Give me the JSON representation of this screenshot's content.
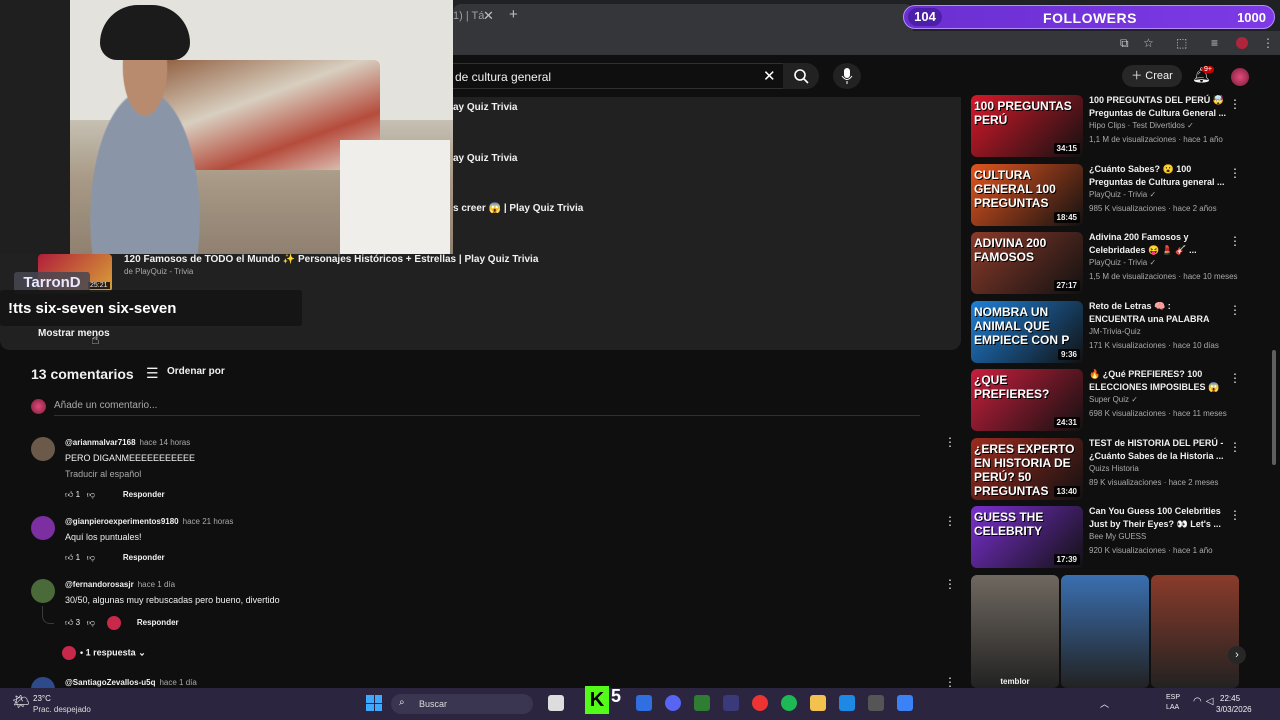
{
  "browser": {
    "tab_fragment": "1) | Tá",
    "tab_close": "✕",
    "new_tab": "+",
    "ext_icons": [
      "cast-icon",
      "star-icon",
      "puzzle-icon",
      "media-icon",
      "profile-icon",
      "menu-icon"
    ]
  },
  "overlay": {
    "followers_count": "104",
    "followers_label": "FOLLOWERS",
    "followers_goal": "1000",
    "streamer_name": "TarronD",
    "tts_message": "!tts six-seven six-seven"
  },
  "header": {
    "search_value": "de cultura general",
    "create_label": "Crear",
    "notifications_badge": "9+"
  },
  "playlist": {
    "rows": [
      {
        "title": "ay Quiz Trivia"
      },
      {
        "title": "ay Quiz Trivia"
      },
      {
        "title": "s creer 😱 | Play Quiz Trivia"
      }
    ],
    "last_item": {
      "title": "120 Famosos de TODO el Mundo ✨ Personajes Históricos + Estrellas | Play Quiz Trivia",
      "channel": "de PlayQuiz - Trivia",
      "duration": "25:21"
    },
    "show_less": "Mostrar menos"
  },
  "comments": {
    "count_label": "13 comentarios",
    "sort_label": "Ordenar por",
    "add_placeholder": "Añade un comentario...",
    "items": [
      {
        "handle": "@arianmalvar7168",
        "time": "hace 14 horas",
        "text": "PERO DIGANMEEEEEEEEEEE",
        "translate": "Traducir al español",
        "likes": "1",
        "reply": "Responder"
      },
      {
        "handle": "@gianpieroexperimentos9180",
        "time": "hace 21 horas",
        "text": "Aquí los puntuales!",
        "likes": "1",
        "reply": "Responder"
      },
      {
        "handle": "@fernandorosasjr",
        "time": "hace 1 día",
        "text": "30/50, algunas muy rebuscadas pero bueno, divertido",
        "likes": "3",
        "reply": "Responder"
      },
      {
        "handle": "@SantiagoZevallos-u5q",
        "time": "hace 1 día"
      }
    ],
    "replies_label": "• 1 respuesta"
  },
  "sidebar": {
    "videos": [
      {
        "thumb_text": "100 PREGUNTAS PERÚ",
        "duration": "34:15",
        "title": "100 PREGUNTAS DEL PERÚ 🤯 Preguntas de Cultura General ...",
        "channel": "Hipo Clips · Test Divertidos ✓",
        "meta": "1,1 M de visualizaciones · hace 1 año",
        "color": "#d7182a"
      },
      {
        "thumb_text": "CULTURA GENERAL 100 PREGUNTAS",
        "duration": "18:45",
        "title": "¿Cuánto Sabes? 😮 100 Preguntas de Cultura general ...",
        "channel": "PlayQuiz - Trivia ✓",
        "meta": "985 K visualizaciones · hace 2 años",
        "color": "#e2541f"
      },
      {
        "thumb_text": "ADIVINA 200 FAMOSOS",
        "duration": "27:17",
        "title": "Adivina 200 Famosos y Celebridades 😝 💄 🎸 ...",
        "channel": "PlayQuiz - Trivia ✓",
        "meta": "1,5 M de visualizaciones · hace 10 meses",
        "color": "#8a3a2a"
      },
      {
        "thumb_text": "NOMBRA UN ANIMAL QUE EMPIECE CON P",
        "duration": "9:36",
        "title": "Reto de Letras 🧠 : ENCUENTRA una PALABRA qu...",
        "channel": "JM-Trivia-Quiz",
        "meta": "171 K visualizaciones · hace 10 días",
        "color": "#1e7fd6"
      },
      {
        "thumb_text": "¿QUE PREFIERES?",
        "duration": "24:31",
        "title": "🔥 ¿Qué PREFIERES? 100 ELECCIONES IMPOSIBLES 😱 ...",
        "channel": "Super Quiz ✓",
        "meta": "698 K visualizaciones · hace 11 meses",
        "color": "#c81e3c"
      },
      {
        "thumb_text": "¿ERES EXPERTO EN HISTORIA DE PERÚ? 50 PREGUNTAS",
        "duration": "13:40",
        "title": "TEST de HISTORIA DEL PERÚ - ¿Cuánto Sabes de la Historia ...",
        "channel": "Quizs Historia",
        "meta": "89 K visualizaciones · hace 2 meses",
        "color": "#9c2a1e"
      },
      {
        "thumb_text": "GUESS THE CELEBRITY",
        "duration": "17:39",
        "title": "Can You Guess 100 Celebrities Just by Their Eyes? 👀 Let's ...",
        "channel": "Bee My GUESS",
        "meta": "920 K visualizaciones · hace 1 año",
        "color": "#7a2fd0"
      }
    ],
    "shorts": [
      {
        "label": "temblor",
        "color": "#6f6860"
      },
      {
        "label": "",
        "color": "#3a6fb0"
      },
      {
        "label": "",
        "color": "#8a3b2a"
      }
    ]
  },
  "taskbar": {
    "temp": "23°C",
    "weather": "Prac. despejado",
    "search_label": "Buscar",
    "lang_top": "ESP",
    "lang_bottom": "LAA",
    "time": "22:45",
    "date": "3/03/2026",
    "kick_letter": "K",
    "kick_number": "5"
  }
}
